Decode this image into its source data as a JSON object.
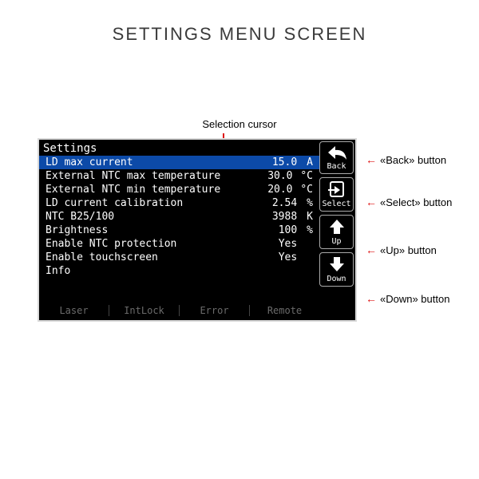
{
  "page_title": "SETTINGS MENU SCREEN",
  "cursor_label": "Selection cursor",
  "screen": {
    "title": "Settings",
    "rows": [
      {
        "label": "LD max current",
        "value": "15.0",
        "unit": "A",
        "selected": true
      },
      {
        "label": "External NTC max temperature",
        "value": "30.0",
        "unit": "°C"
      },
      {
        "label": "External NTC min temperature",
        "value": "20.0",
        "unit": "°C"
      },
      {
        "label": "LD current calibration",
        "value": "2.54",
        "unit": "%"
      },
      {
        "label": "NTC B25/100",
        "value": "3988",
        "unit": "K"
      },
      {
        "label": "Brightness",
        "value": "100",
        "unit": "%"
      },
      {
        "label": "Enable NTC protection",
        "value": "Yes",
        "unit": ""
      },
      {
        "label": "Enable touchscreen",
        "value": "Yes",
        "unit": ""
      },
      {
        "label": "Info",
        "value": "",
        "unit": ""
      }
    ],
    "status": [
      "Laser",
      "IntLock",
      "Error",
      "Remote"
    ]
  },
  "side_buttons": [
    {
      "label": "Back",
      "icon": "back"
    },
    {
      "label": "Select",
      "icon": "select"
    },
    {
      "label": "Up",
      "icon": "up"
    },
    {
      "label": "Down",
      "icon": "down"
    }
  ],
  "annotations": {
    "back": "«Back» button",
    "select": "«Select» button",
    "up": "«Up» button",
    "down": "«Down» button"
  }
}
